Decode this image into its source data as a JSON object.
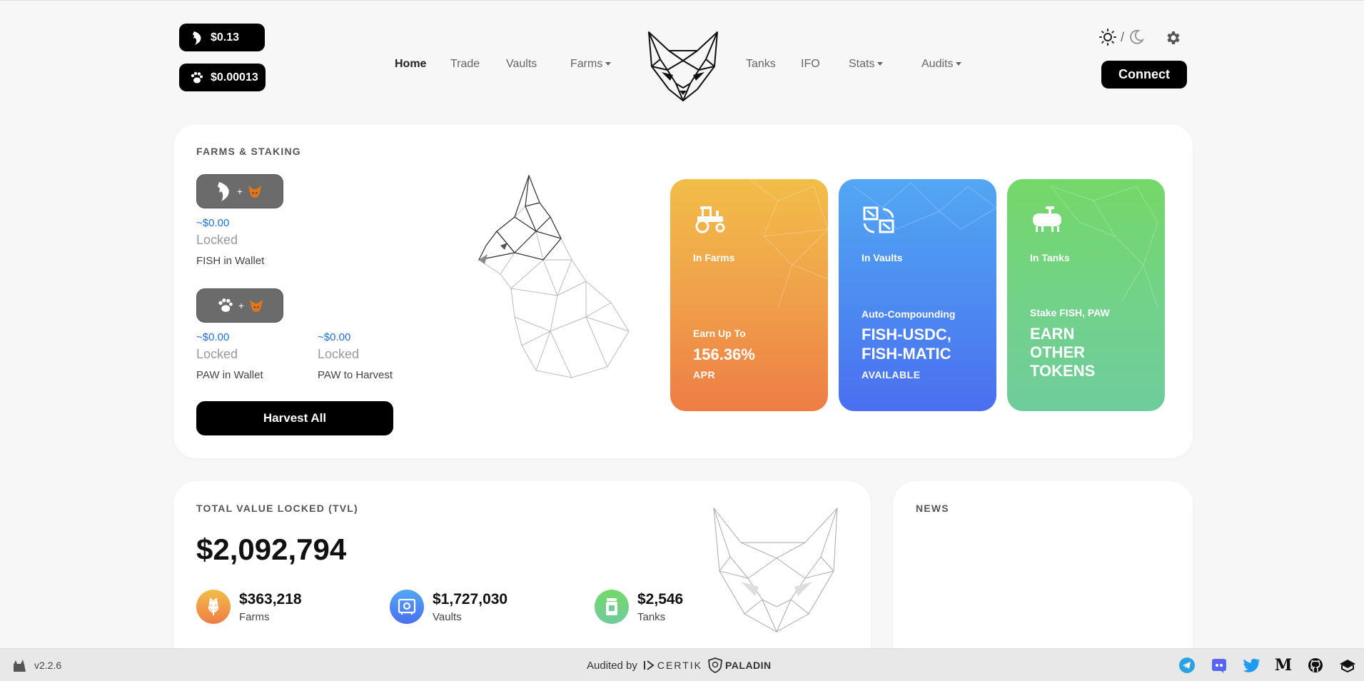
{
  "header": {
    "fish_price": "$0.13",
    "paw_price": "$0.00013",
    "nav": {
      "home": "Home",
      "trade": "Trade",
      "vaults": "Vaults",
      "farms": "Farms",
      "tanks": "Tanks",
      "ifo": "IFO",
      "stats": "Stats",
      "audits": "Audits"
    },
    "theme_separator": "/",
    "connect_label": "Connect"
  },
  "farms_staking": {
    "title": "FARMS & STAKING",
    "fish": {
      "usd": "~$0.00",
      "locked": "Locked",
      "label": "FISH in Wallet"
    },
    "paw_wallet": {
      "usd": "~$0.00",
      "locked": "Locked",
      "label": "PAW in Wallet"
    },
    "paw_harvest": {
      "usd": "~$0.00",
      "locked": "Locked",
      "label": "PAW to Harvest"
    },
    "harvest_all_label": "Harvest All",
    "plus": "+",
    "promos": {
      "farms": {
        "in_label": "In Farms",
        "sub": "Earn Up To",
        "big": "156.36%",
        "tail": "APR",
        "color": "#ee7d45"
      },
      "vaults": {
        "in_label": "In Vaults",
        "sub": "Auto-Compounding",
        "big_line1": "FISH-USDC,",
        "big_line2": "FISH-MATIC",
        "tail": "AVAILABLE",
        "color": "#4a6ff0"
      },
      "tanks": {
        "in_label": "In Tanks",
        "sub": "Stake FISH, PAW",
        "big_line1": "EARN",
        "big_line2": "OTHER",
        "big_line3": "TOKENS",
        "color": "#6fcc9c"
      }
    }
  },
  "tvl": {
    "title": "TOTAL VALUE LOCKED (TVL)",
    "value": "$2,092,794",
    "farms_value": "$363,218",
    "farms_label": "Farms",
    "vaults_value": "$1,727,030",
    "vaults_label": "Vaults",
    "tanks_value": "$2,546",
    "tanks_label": "Tanks"
  },
  "news": {
    "title": "NEWS"
  },
  "footer": {
    "version": "v2.2.6",
    "audited_by": "Audited by",
    "certik": "CERTIK",
    "paladin": "PALADIN"
  }
}
